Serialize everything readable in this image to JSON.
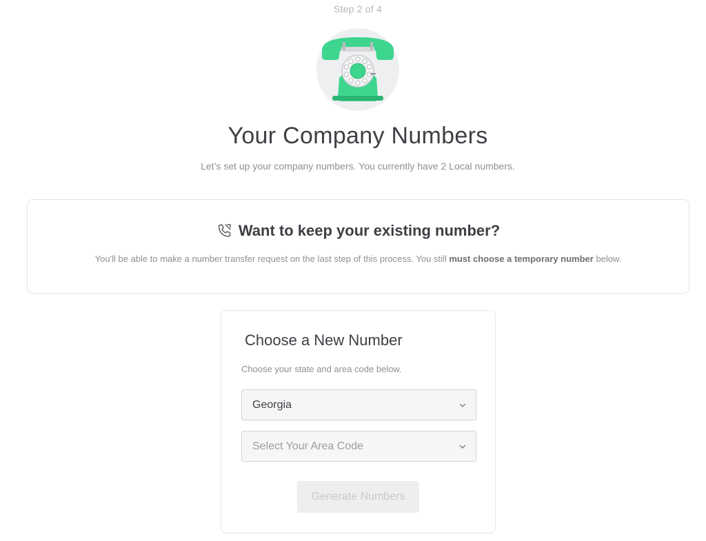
{
  "header": {
    "step": "Step 2 of 4",
    "title": "Your Company Numbers",
    "subtitle": "Let’s set up your company numbers. You currently have 2 Local numbers."
  },
  "notice": {
    "icon": "phone-forward-icon",
    "title": "Want to keep your existing number?",
    "text_before": "You'll be able to make a number transfer request on the last step of this process. You still ",
    "text_bold": "must choose a temporary number",
    "text_after": " below."
  },
  "card": {
    "title": "Choose a New Number",
    "description": "Choose your state and area code below.",
    "state_select": {
      "value": "Georgia"
    },
    "area_select": {
      "placeholder": "Select Your Area Code"
    },
    "generate_button": "Generate Numbers"
  },
  "colors": {
    "accent_green": "#3ed58f",
    "accent_green_dark": "#2bb574",
    "text_dark": "#3d3f44",
    "text_muted": "#8c8f94"
  }
}
